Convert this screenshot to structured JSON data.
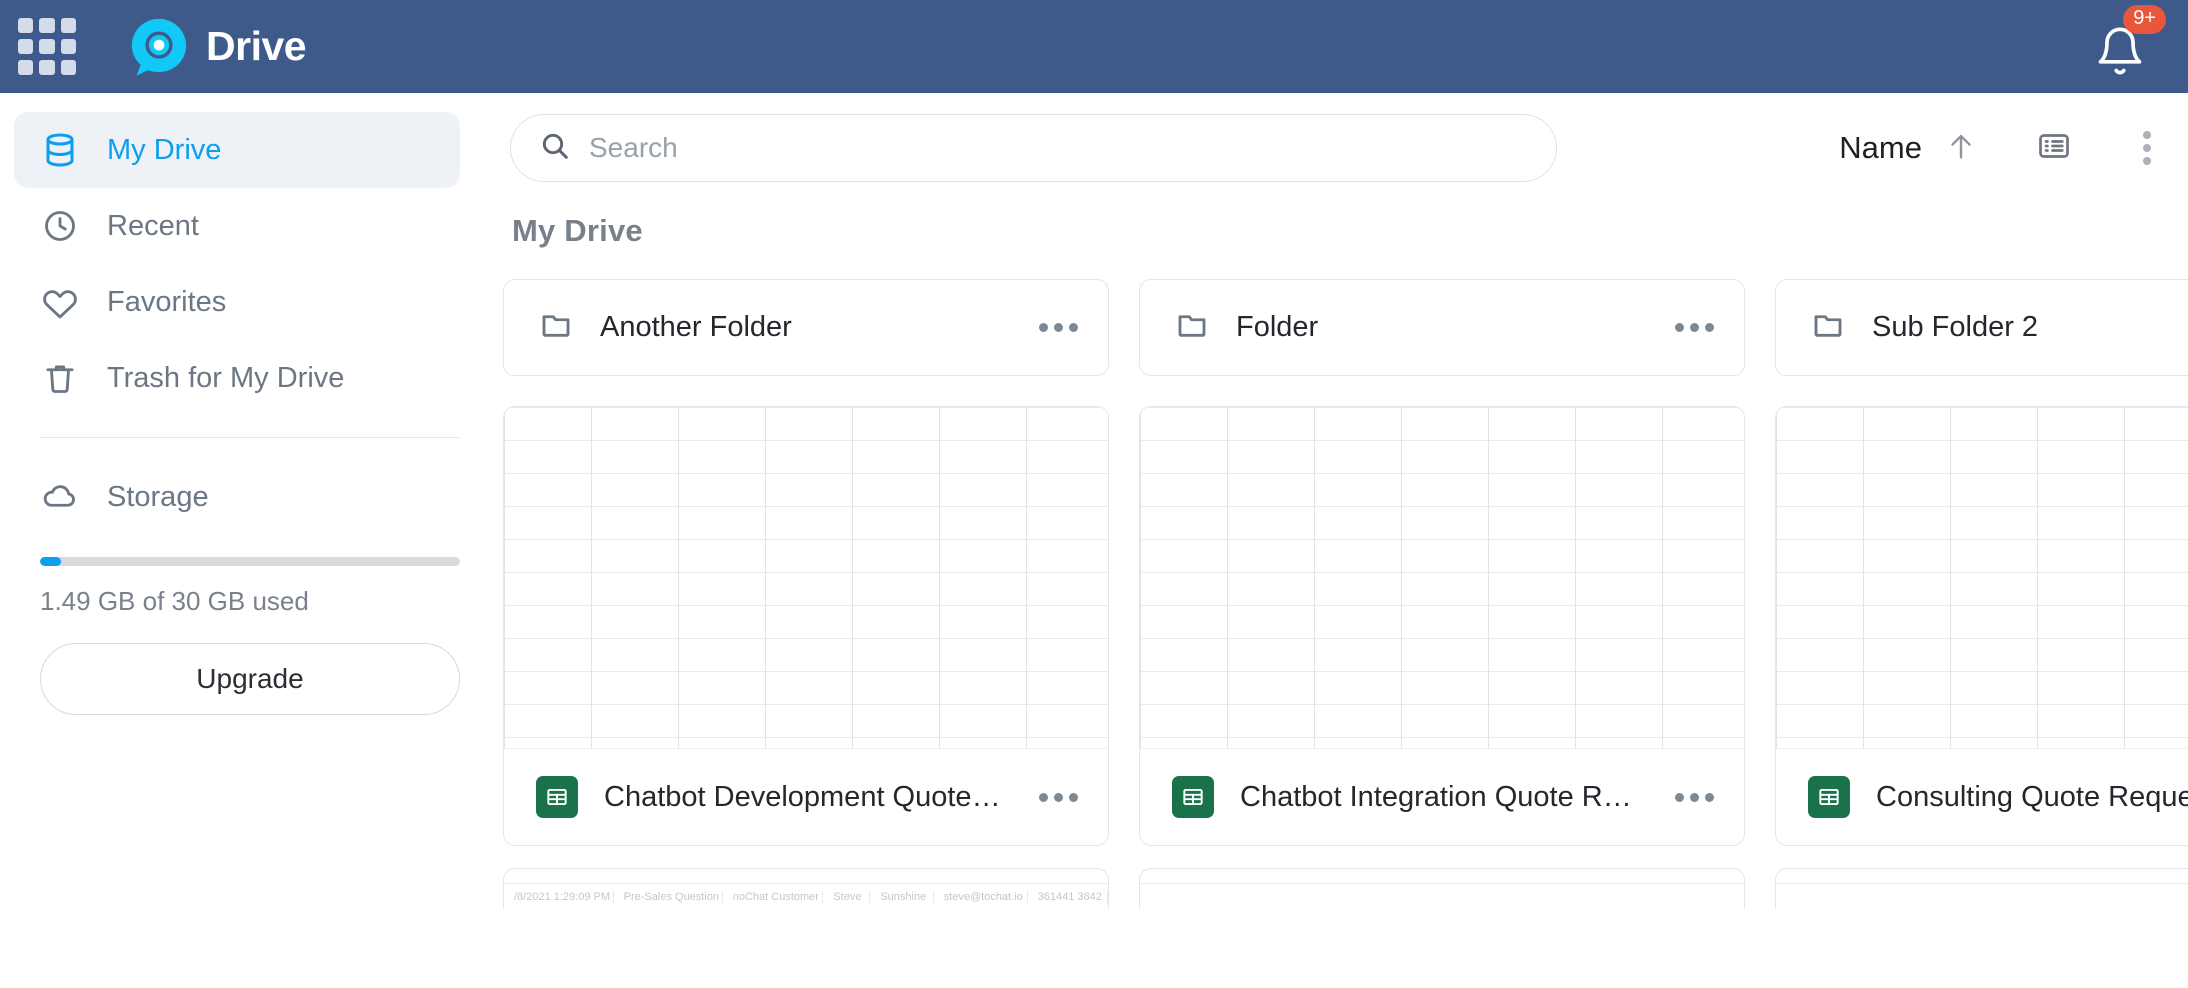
{
  "header": {
    "brand": "Drive",
    "apps_icon": "apps-grid-icon",
    "logo_icon": "drive-logo-icon",
    "bell_icon": "bell-icon",
    "notification_count": "9+"
  },
  "sidebar": {
    "items": [
      {
        "label": "My Drive",
        "icon": "database-icon",
        "active": true
      },
      {
        "label": "Recent",
        "icon": "clock-icon",
        "active": false
      },
      {
        "label": "Favorites",
        "icon": "heart-icon",
        "active": false
      },
      {
        "label": "Trash for My Drive",
        "icon": "trash-icon",
        "active": false
      }
    ],
    "storage": {
      "label": "Storage",
      "icon": "cloud-icon",
      "used_text": "1.49 GB of 30 GB used",
      "used_percent": 5,
      "upgrade_label": "Upgrade"
    }
  },
  "toolbar": {
    "search_placeholder": "Search",
    "search_value": "",
    "search_icon": "search-icon",
    "sort_label": "Name",
    "sort_direction_icon": "arrow-up-icon",
    "view_toggle_icon": "list-view-icon",
    "more_menu_icon": "more-vertical-icon"
  },
  "main": {
    "breadcrumb": "My Drive",
    "folders": [
      {
        "name": "Another Folder",
        "icon": "folder-icon",
        "menu_icon": "more-horizontal-icon"
      },
      {
        "name": "Folder",
        "icon": "folder-icon",
        "menu_icon": "more-horizontal-icon"
      },
      {
        "name": "Sub Folder 2",
        "icon": "folder-icon",
        "menu_icon": "more-horizontal-icon"
      }
    ],
    "files": [
      {
        "name": "Chatbot Development Quote R…",
        "icon": "spreadsheet-icon",
        "menu_icon": "more-horizontal-icon"
      },
      {
        "name": "Chatbot Integration Quote Req…",
        "icon": "spreadsheet-icon",
        "menu_icon": "more-horizontal-icon"
      },
      {
        "name": "Consulting Quote Reques",
        "icon": "spreadsheet-icon",
        "menu_icon": "more-horizontal-icon"
      }
    ],
    "peek_row_cells": [
      "/8/2021 1:29:09 PM",
      "Pre-Sales Question",
      "noChat Customer",
      "Steve",
      "Sunshine",
      "steve@tochat.io",
      "361441 3842"
    ]
  },
  "colors": {
    "header_bg": "#3e5a8a",
    "accent": "#0d9fef",
    "badge": "#e8563c",
    "sheet_green": "#19724a",
    "active_item_bg": "#eef2f6"
  }
}
